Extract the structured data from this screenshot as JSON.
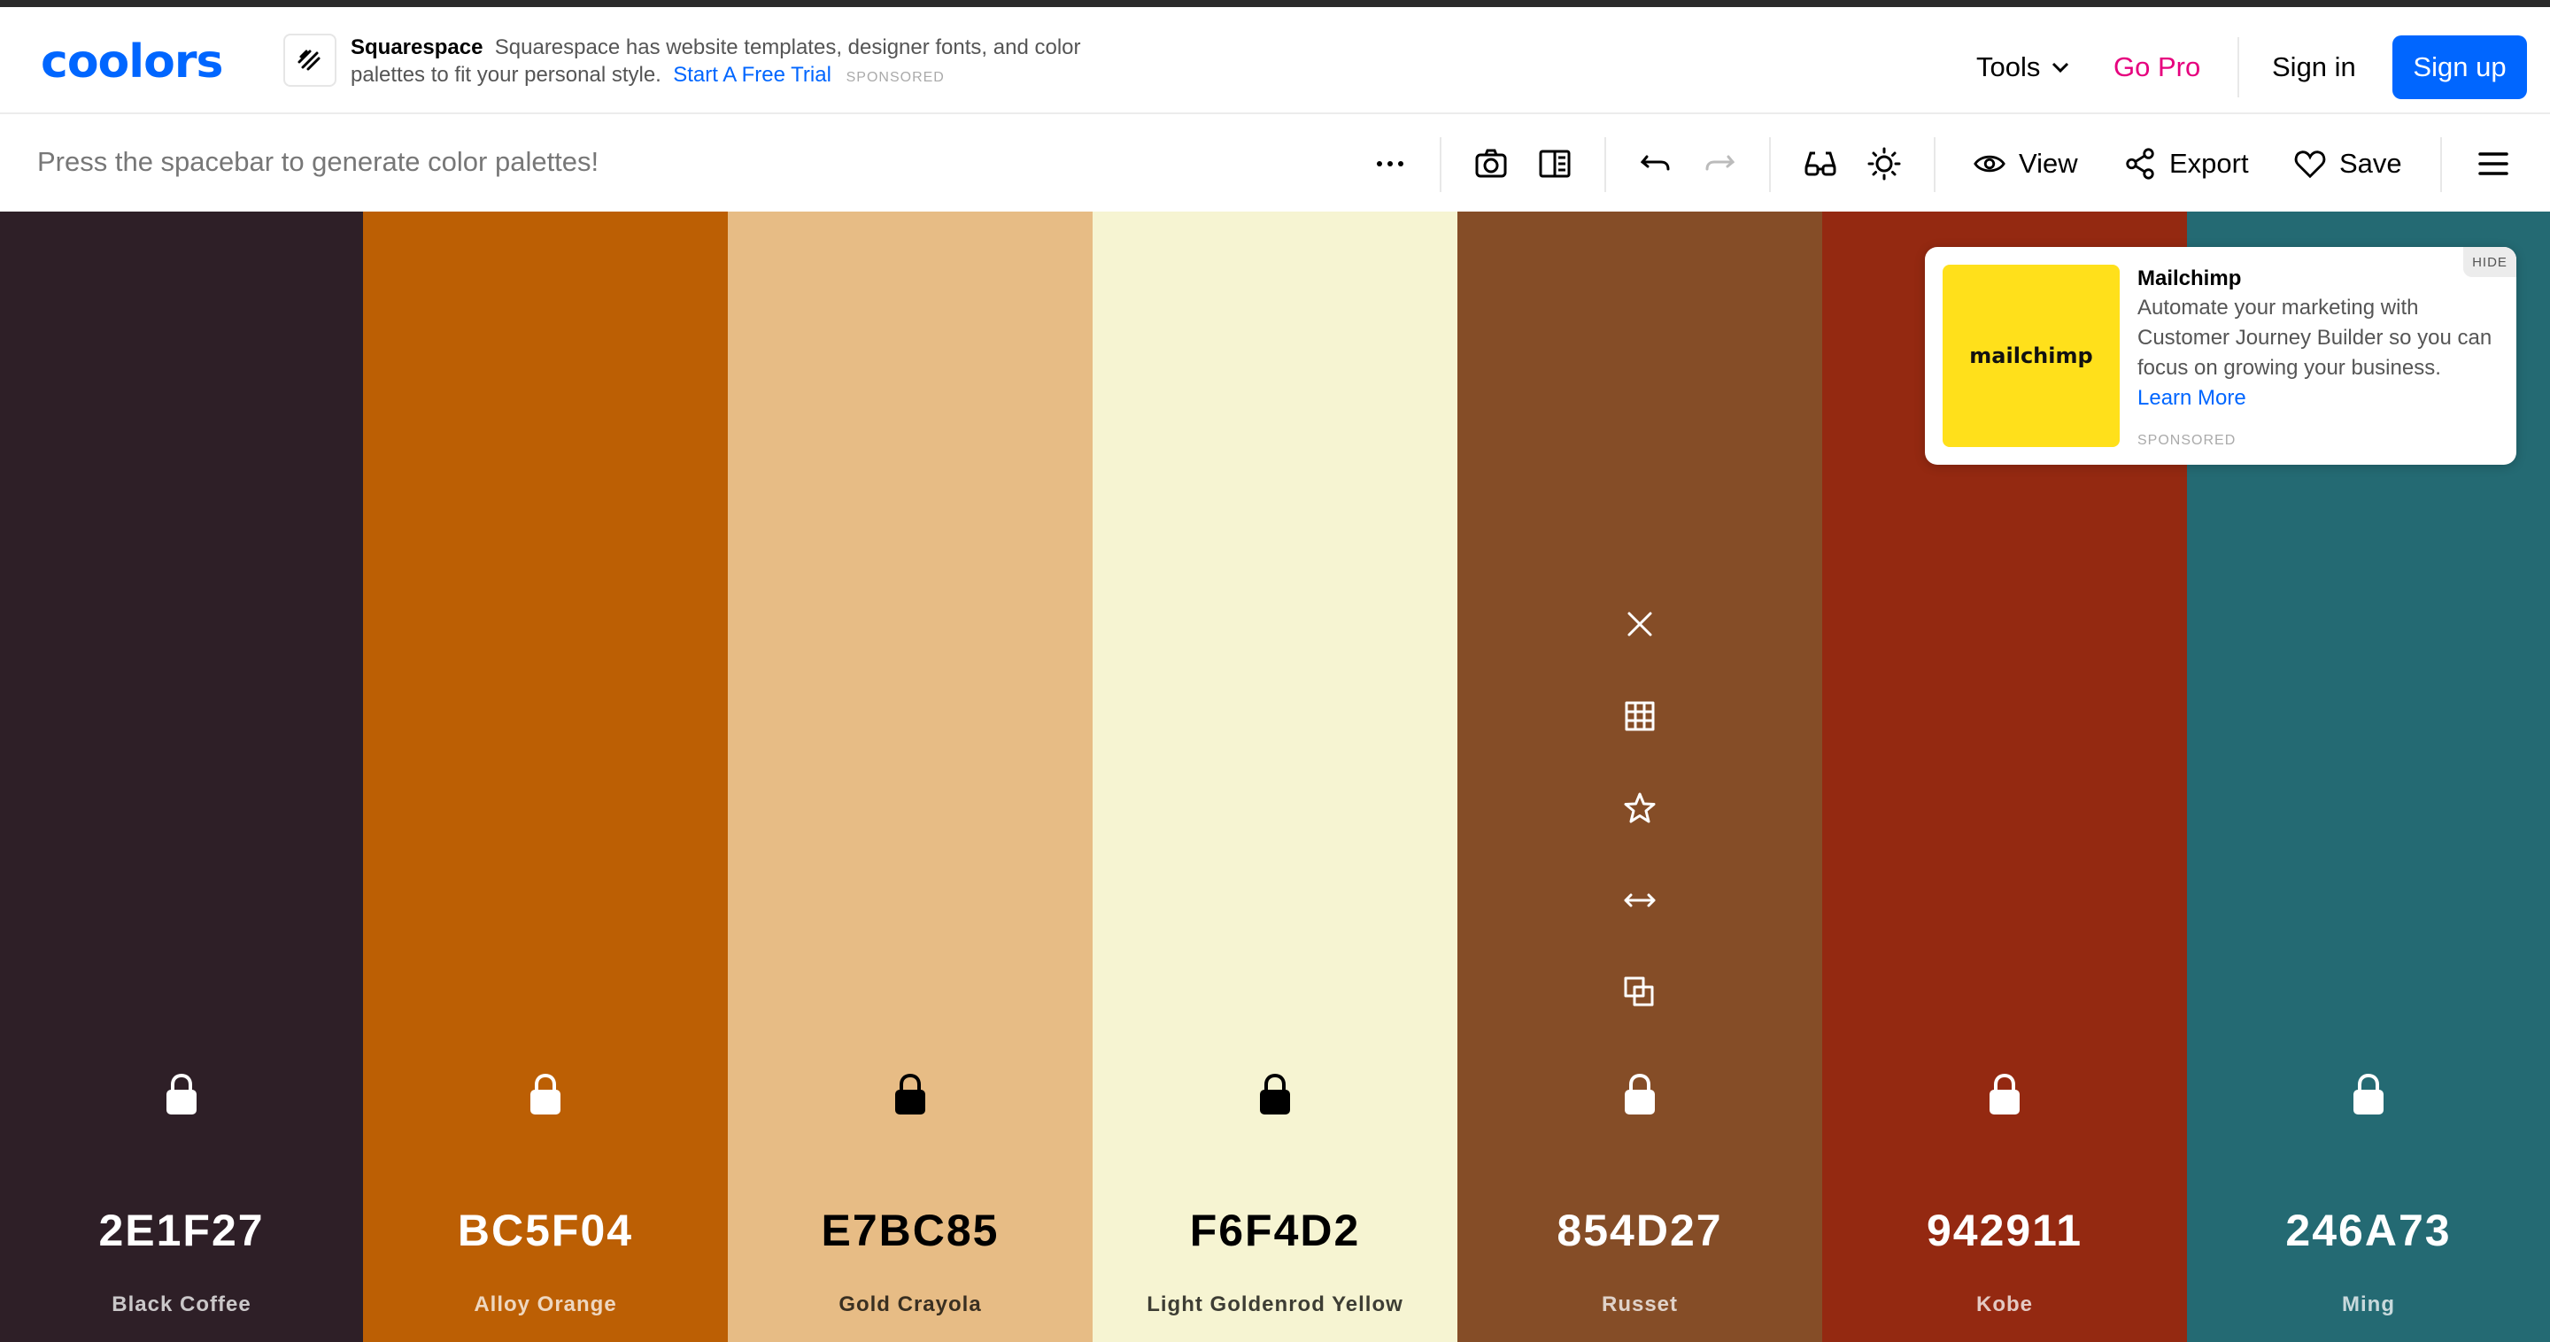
{
  "header": {
    "logo": "coolors",
    "ad": {
      "brand": "Squarespace",
      "text": "Squarespace has website templates, designer fonts, and color palettes to fit your personal style.",
      "cta": "Start A Free Trial",
      "sponsored": "SPONSORED",
      "icon": "squarespace-icon"
    },
    "nav": {
      "tools": "Tools",
      "gopro": "Go Pro",
      "signin": "Sign in",
      "signup": "Sign up"
    }
  },
  "toolbar": {
    "hint": "Press the spacebar to generate color palettes!",
    "view": "View",
    "export": "Export",
    "save": "Save"
  },
  "palette": [
    {
      "hex": "2E1F27",
      "name": "Black Coffee",
      "bg": "#2e1f27",
      "fg": "#ffffff"
    },
    {
      "hex": "BC5F04",
      "name": "Alloy Orange",
      "bg": "#bc5f04",
      "fg": "#ffffff"
    },
    {
      "hex": "E7BC85",
      "name": "Gold Crayola",
      "bg": "#e7bc85",
      "fg": "#000000"
    },
    {
      "hex": "F6F4D2",
      "name": "Light Goldenrod Yellow",
      "bg": "#f6f4d2",
      "fg": "#000000"
    },
    {
      "hex": "854D27",
      "name": "Russet",
      "bg": "#854d27",
      "fg": "#ffffff"
    },
    {
      "hex": "942911",
      "name": "Kobe",
      "bg": "#942911",
      "fg": "#ffffff"
    },
    {
      "hex": "246A73",
      "name": "Ming",
      "bg": "#246a73",
      "fg": "#ffffff"
    }
  ],
  "ad_card": {
    "title": "Mailchimp",
    "text": "Automate your marketing with Customer Journey Builder so you can focus on growing your business.",
    "cta": "Learn More",
    "sponsored": "SPONSORED",
    "hide": "HIDE",
    "logo_text": "mailchimp"
  },
  "colors": {
    "accent": "#0066ff",
    "gopro": "#e6007e"
  }
}
